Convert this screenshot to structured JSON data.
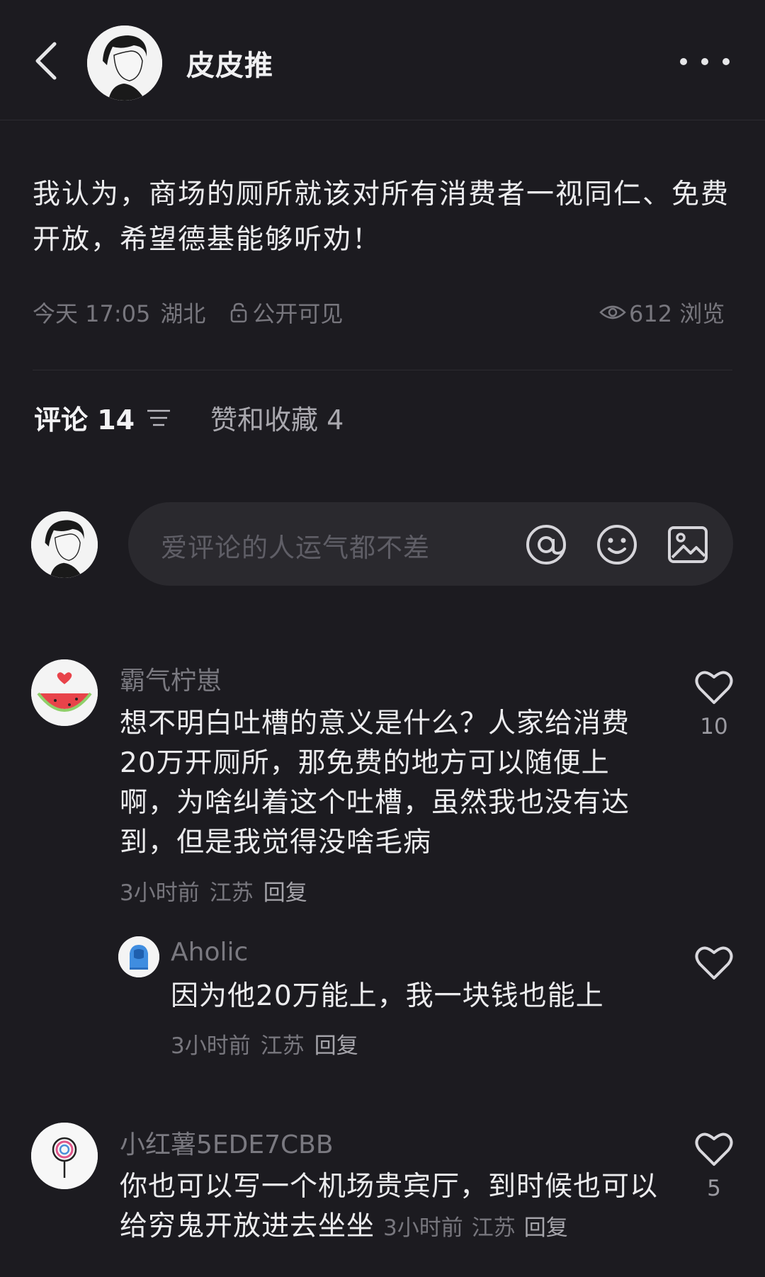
{
  "header": {
    "author_name": "皮皮推"
  },
  "post": {
    "text": "我认为，商场的厕所就该对所有消费者一视同仁、免费开放，希望德基能够听劝！",
    "time": "今天 17:05",
    "location": "湖北",
    "visibility": "公开可见",
    "views": "612 浏览"
  },
  "tabs": {
    "comments": "评论 14",
    "likes": "赞和收藏 4"
  },
  "comment_input": {
    "placeholder": "爱评论的人运气都不差"
  },
  "comments": [
    {
      "user": "霸气柠崽",
      "text": "想不明白吐槽的意义是什么？人家给消费20万开厕所，那免费的地方可以随便上啊，为啥纠着这个吐槽，虽然我也没有达到，但是我觉得没啥毛病",
      "time": "3小时前",
      "location": "江苏",
      "reply": "回复",
      "likes": "10",
      "replies": [
        {
          "user": "Aholic",
          "text": "因为他20万能上，我一块钱也能上",
          "time": "3小时前",
          "location": "江苏",
          "reply": "回复"
        }
      ]
    },
    {
      "user": "小红薯5EDE7CBB",
      "text": "你也可以写一个机场贵宾厅，到时候也可以给穷鬼开放进去坐坐",
      "time": "3小时前",
      "location": "江苏",
      "reply": "回复",
      "likes": "5"
    }
  ],
  "colors": {
    "background": "#1c1b20",
    "primary_text": "#ececee",
    "secondary_text": "#78777e",
    "input_bg": "#2a292e"
  },
  "icons": [
    "back-arrow-icon",
    "more-icon",
    "lock-icon",
    "eye-icon",
    "filter-icon",
    "at-icon",
    "emoji-icon",
    "image-icon",
    "heart-icon"
  ]
}
